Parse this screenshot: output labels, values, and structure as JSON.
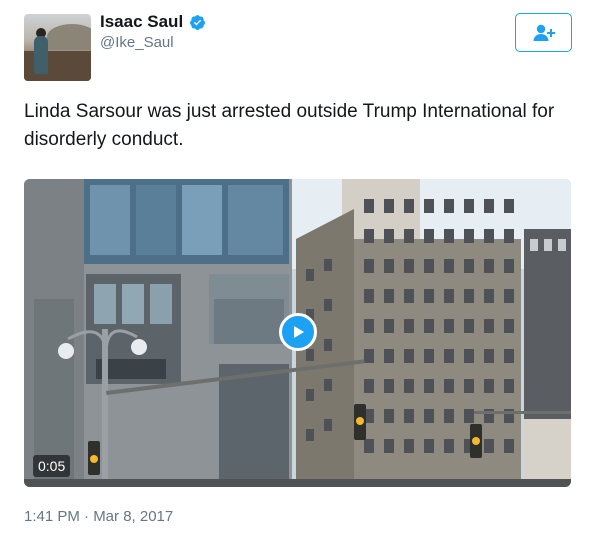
{
  "author": {
    "display_name": "Isaac Saul",
    "handle": "@Ike_Saul",
    "verified": true,
    "avatar_icon": "profile-photo"
  },
  "follow_button": {
    "icon": "follow-user-plus-icon",
    "color": "#1da1f2"
  },
  "tweet": {
    "text": "Linda Sarsour was just arrested outside Trump International for disorderly conduct."
  },
  "video": {
    "duration": "0:05",
    "play_icon": "play-icon",
    "accent_color": "#1da1f2"
  },
  "timestamp": "1:41 PM · Mar 8, 2017"
}
